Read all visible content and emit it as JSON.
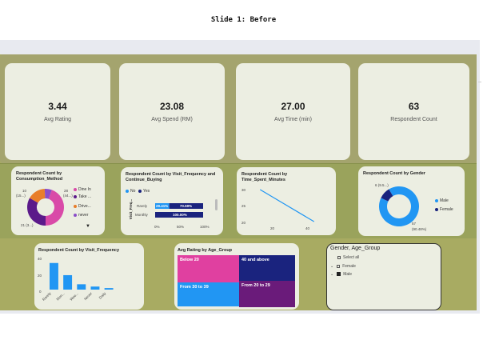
{
  "slide": {
    "title": "Slide 1: Before"
  },
  "kpis": [
    {
      "value": "3.44",
      "label": "Avg Rating"
    },
    {
      "value": "23.08",
      "label": "Avg Spend (RM)"
    },
    {
      "value": "27.00",
      "label": "Avg Time (min)"
    },
    {
      "value": "63",
      "label": "Respondent Count"
    }
  ],
  "consumption": {
    "title": "Respondent Count by Consumption_Method",
    "labels": {
      "top_left": "10",
      "top_left2": "(15...)",
      "top_right": "28",
      "top_right2": "(44...)",
      "bottom": "21 (3...)"
    },
    "legend": [
      "Dine In",
      "Take ...",
      "Drive...",
      "never"
    ],
    "colors": [
      "#d94aa8",
      "#5b1a8a",
      "#e87e2a",
      "#8a4dc7"
    ]
  },
  "visit_continue": {
    "title": "Respondent Count by Visit_Frequency and Continue_Buying",
    "legend": [
      "No",
      "Yes"
    ],
    "y_axis_title": "Visit_Freq...",
    "rows": [
      {
        "label": "Rarely",
        "no_pct": 29.41,
        "yes_pct": 70.59,
        "no_text": "29.41%",
        "yes_text": "70.59%"
      },
      {
        "label": "Monthly",
        "no_pct": 0,
        "yes_pct": 100,
        "no_text": "",
        "yes_text": "100.00%"
      }
    ],
    "x_ticks": [
      "0%",
      "50%",
      "100%"
    ],
    "colors": {
      "no": "#2196f3",
      "yes": "#1a237e"
    }
  },
  "time_spent": {
    "title": "Respondent Count by Time_Spent_Minutes",
    "y_ticks": [
      "30",
      "25",
      "20"
    ],
    "x_ticks": [
      "20",
      "40"
    ],
    "color": "#2196f3"
  },
  "gender": {
    "title": "Respondent Count by Gender",
    "labels": {
      "top": "6 (9.5...)",
      "bottom": "57",
      "bottom2": "(90.48%)"
    },
    "legend": [
      "Male",
      "Female"
    ],
    "colors": {
      "male": "#2196f3",
      "female": "#1a237e"
    }
  },
  "visit_freq": {
    "title": "Respondent Count by Visit_Frequency",
    "y_ticks": [
      "40",
      "20",
      "0"
    ],
    "categories": [
      "Rarely",
      "Mon...",
      "Wee...",
      "Never",
      "Daily"
    ],
    "color": "#2196f3"
  },
  "age_rating": {
    "title": "Avg Rating by Age_Group",
    "cells": [
      "Below 20",
      "40 and above",
      "From 30 to 39",
      "From 20 to 29"
    ],
    "colors": [
      "#e040a0",
      "#1a237e",
      "#2196f3",
      "#6a1b7a"
    ]
  },
  "slicer": {
    "title": "Gender, Age_Group",
    "items": [
      "Select all",
      "Female",
      "Male"
    ]
  },
  "chart_data": [
    {
      "type": "pie",
      "title": "Respondent Count by Consumption_Method",
      "categories": [
        "Dine In",
        "Take ...",
        "Drive...",
        "never"
      ],
      "values": [
        28,
        21,
        10,
        4
      ]
    },
    {
      "type": "bar",
      "title": "Respondent Count by Visit_Frequency and Continue_Buying",
      "categories": [
        "Rarely",
        "Monthly"
      ],
      "series": [
        {
          "name": "No",
          "values": [
            29.41,
            0
          ]
        },
        {
          "name": "Yes",
          "values": [
            70.59,
            100.0
          ]
        }
      ],
      "ylabel": "Visit_Freq..."
    },
    {
      "type": "line",
      "title": "Respondent Count by Time_Spent_Minutes",
      "x": [
        10,
        40
      ],
      "values": [
        30,
        20
      ],
      "ylim": [
        20,
        30
      ]
    },
    {
      "type": "pie",
      "title": "Respondent Count by Gender",
      "categories": [
        "Male",
        "Female"
      ],
      "values": [
        57,
        6
      ]
    },
    {
      "type": "bar",
      "title": "Respondent Count by Visit_Frequency",
      "categories": [
        "Rarely",
        "Mon...",
        "Wee...",
        "Never",
        "Daily"
      ],
      "values": [
        35,
        19,
        7,
        4,
        2
      ],
      "ylim": [
        0,
        40
      ]
    }
  ]
}
